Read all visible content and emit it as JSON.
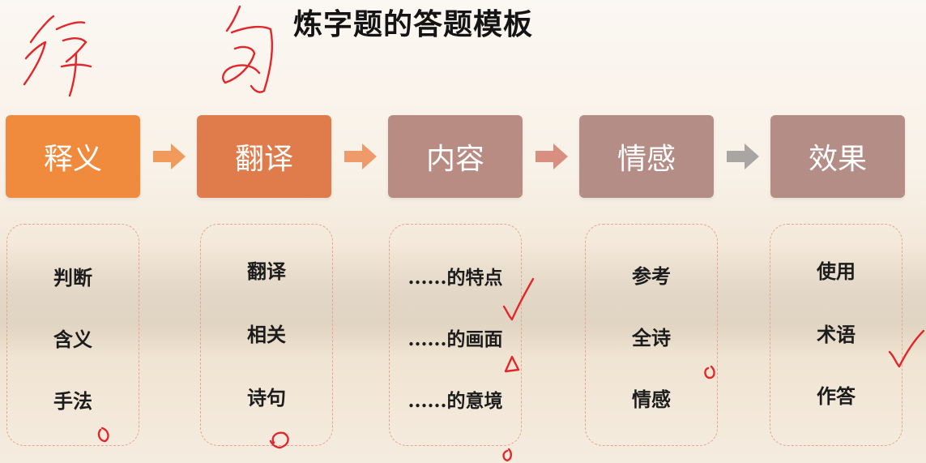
{
  "title": "炼字题的答题模板",
  "steps": [
    {
      "label": "释义",
      "items": [
        "判断",
        "含义",
        "手法"
      ]
    },
    {
      "label": "翻译",
      "items": [
        "翻译",
        "相关",
        "诗句"
      ]
    },
    {
      "label": "内容",
      "items": [
        "......的特点",
        "......的画面",
        "......的意境"
      ]
    },
    {
      "label": "情感",
      "items": [
        "参考",
        "全诗",
        "情感"
      ]
    },
    {
      "label": "效果",
      "items": [
        "使用",
        "术语",
        "作答"
      ]
    }
  ],
  "colors": {
    "step_1": "#f08a3c",
    "step_2": "#e07b4c",
    "step_3_5": "#b48d86",
    "arrow_orange": "#f29a5b",
    "arrow_gray": "#a9a5a3",
    "card_border": "#e6a58c",
    "handwriting": "#e3262b"
  },
  "annotations": {
    "note": "handwritten red marks: 字, 句, check marks and small circles/triangles",
    "icons": [
      "arrow-right",
      "check-mark",
      "circle-mark",
      "triangle-mark"
    ]
  }
}
